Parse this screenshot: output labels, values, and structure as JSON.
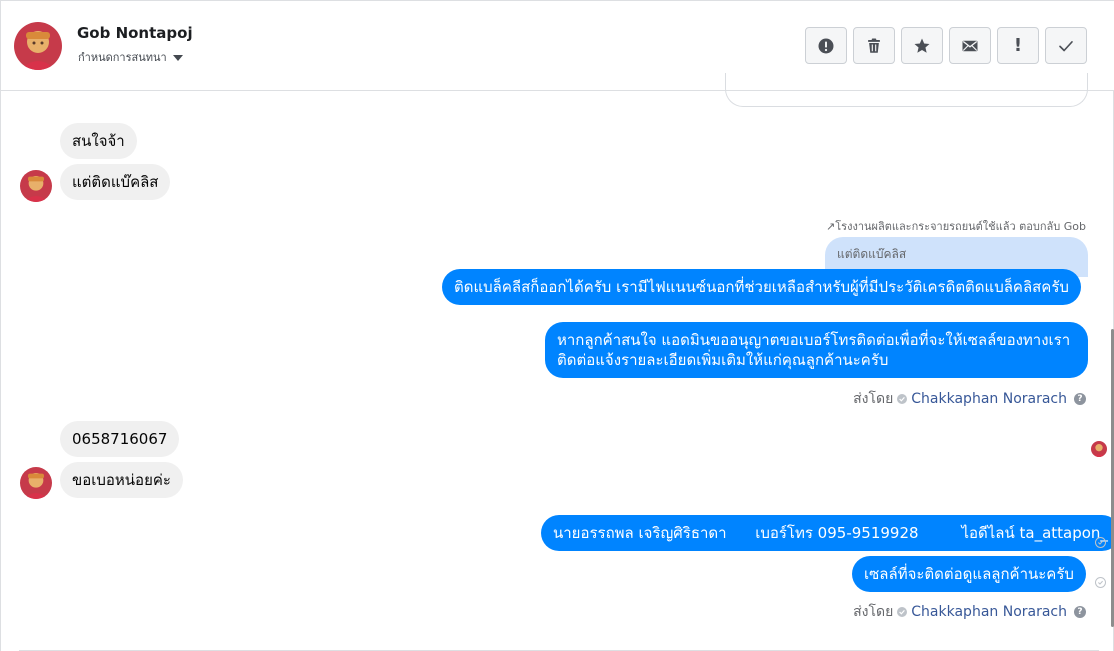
{
  "header": {
    "contact_name": "Gob Nontapoj",
    "assign_label": "กำหนดการสนทนา"
  },
  "toolbar": {
    "icons": [
      "alert-circle-icon",
      "trash-icon",
      "star-icon",
      "mail-icon",
      "exclamation-icon",
      "check-icon"
    ],
    "exclamation_text": "!"
  },
  "messages": {
    "in_1": "สนใจจ้า",
    "in_2": "แต่ติดแบ๊คลิส",
    "reply_meta": "โรงงานผลิตและกระจายรถยนต์ใช้แล้ว ตอบกลับ Gob",
    "reply_quote": "แต่ติดแบ๊คลิส",
    "out_1": "ติดแบล็คลีสก็ออกได้ครับ เรามีไฟแนนซ์นอกที่ช่วยเหลือสำหรับผู้ที่มีประวัติเครดิตติดแบล็คลิสครับ",
    "out_2_line1": "หากลูกค้าสนใจ แอดมินขออนุญาตขอเบอร์โทรติดต่อเพื่อที่จะให้เซลล์ของทางเรา",
    "out_2_line2": "ติดต่อแจ้งรายละเอียดเพิ่มเติมให้แก่คุณลูกค้านะครับ",
    "in_3": "0658716067",
    "in_4": "ขอเบอหน่อยค่ะ",
    "out_3": "นายอรรถพล เจริญศิริธาดา      เบอร์โทร 095-9519928         ไอดีไลน์ ta_attapon_",
    "out_4": "เซลล์ที่จะติดต่อดูแลลูกค้านะครับ"
  },
  "sent_by": {
    "label": "ส่งโดย",
    "agent": "Chakkaphan Norarach",
    "help": "?"
  },
  "colors": {
    "outgoing_bubble": "#0084ff",
    "incoming_bubble": "#f0f0f0",
    "reply_quote_bg": "#cfe2fb",
    "agent_link": "#385898"
  }
}
